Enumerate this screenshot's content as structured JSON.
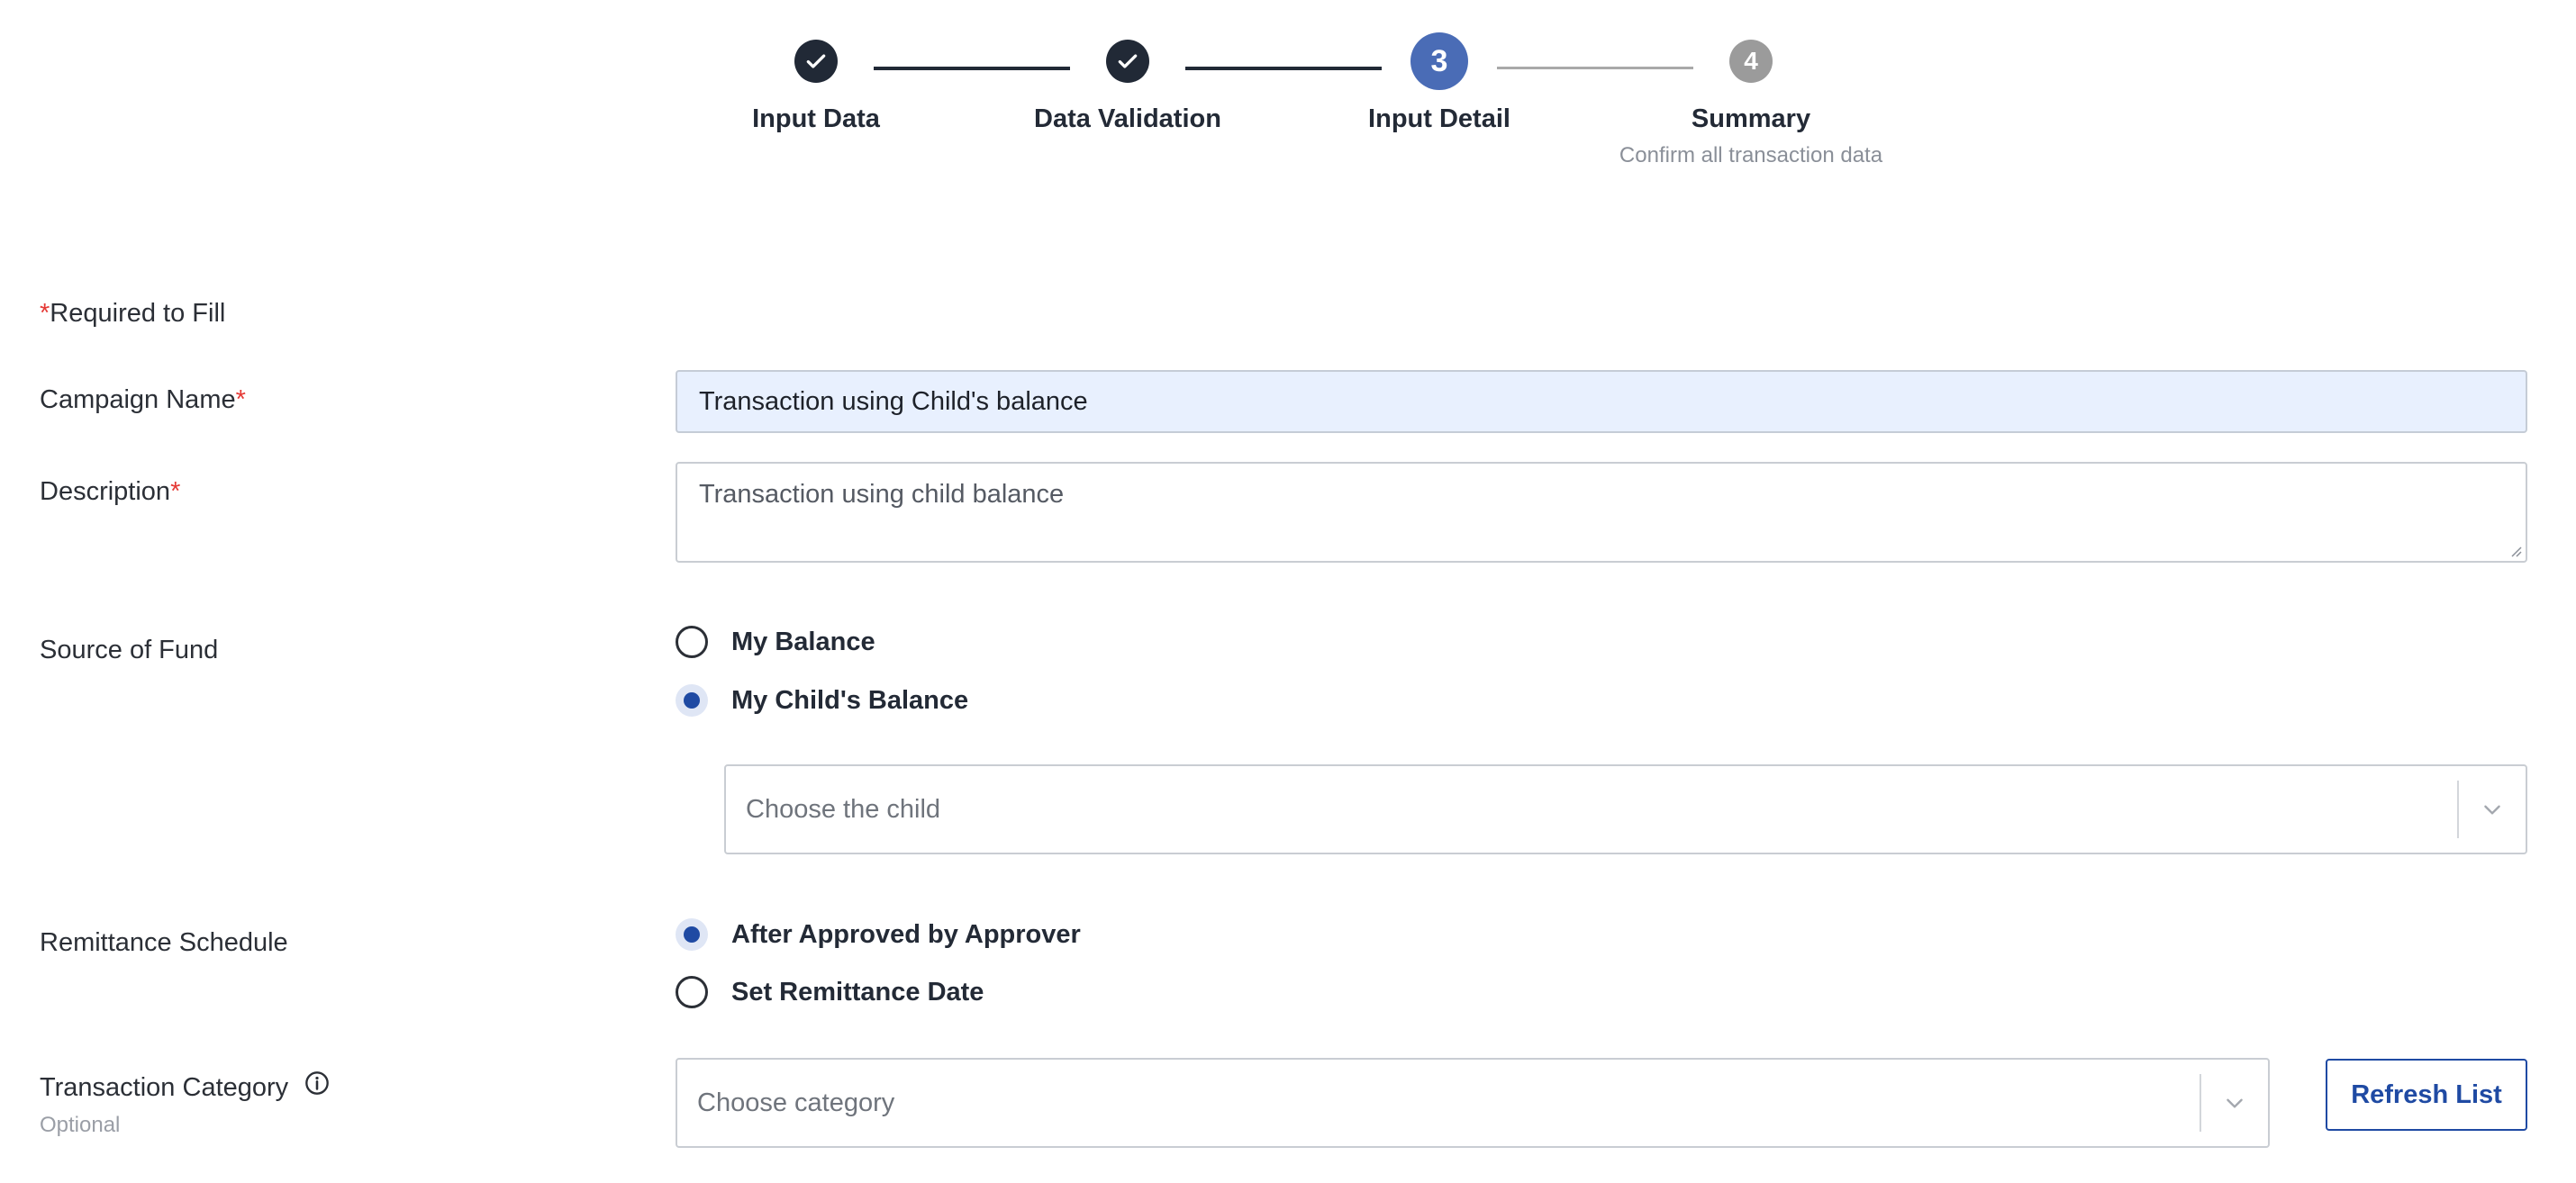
{
  "stepper": {
    "steps": [
      {
        "number": "1",
        "label": "Input Data",
        "state": "done",
        "subtitle": ""
      },
      {
        "number": "2",
        "label": "Data Validation",
        "state": "done",
        "subtitle": ""
      },
      {
        "number": "3",
        "label": "Input Detail",
        "state": "current",
        "subtitle": ""
      },
      {
        "number": "4",
        "label": "Summary",
        "state": "todo",
        "subtitle": "Confirm all transaction data"
      }
    ]
  },
  "form": {
    "required_note": "Required to Fill",
    "required_mark": "*",
    "campaign_name": {
      "label": "Campaign Name",
      "value": "Transaction using Child's balance"
    },
    "description": {
      "label": "Description",
      "value": "Transaction using child balance"
    },
    "source_of_fund": {
      "label": "Source of Fund",
      "options": [
        {
          "label": "My Balance",
          "checked": false
        },
        {
          "label": "My Child's Balance",
          "checked": true
        }
      ],
      "child_select": {
        "placeholder": "Choose the child"
      }
    },
    "remittance_schedule": {
      "label": "Remittance Schedule",
      "options": [
        {
          "label": "After Approved by Approver",
          "checked": true
        },
        {
          "label": "Set Remittance Date",
          "checked": false
        }
      ]
    },
    "transaction_category": {
      "label": "Transaction Category",
      "optional": "Optional",
      "select": {
        "placeholder": "Choose category"
      },
      "refresh_button": "Refresh List"
    }
  },
  "colors": {
    "primary": "#1f4aa3",
    "step_current": "#4a6cb6",
    "step_done": "#212936",
    "step_todo": "#9b9b9b",
    "required": "#e53935",
    "filled_input_bg": "#e8f0fe"
  },
  "icons": [
    "check-icon",
    "chevron-down-icon",
    "info-icon",
    "resize-grip-icon"
  ]
}
